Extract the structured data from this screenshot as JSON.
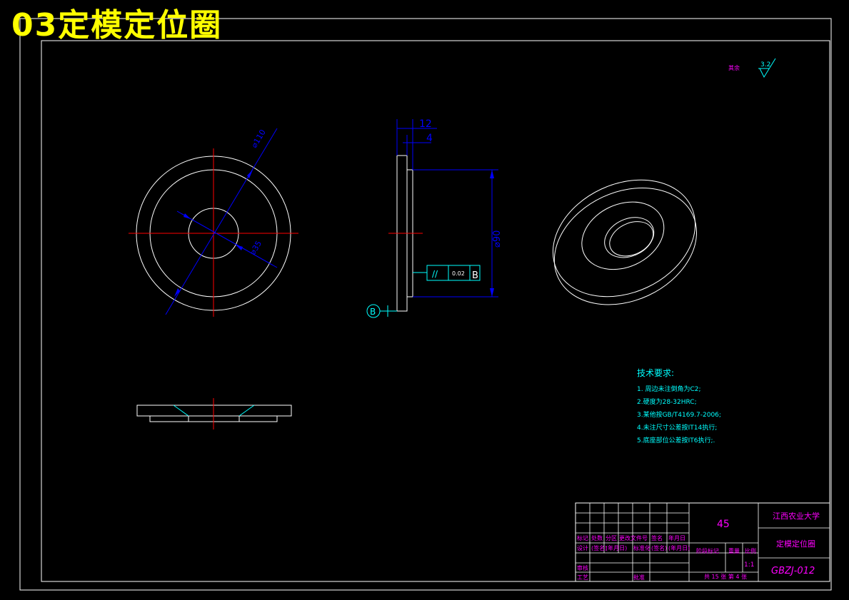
{
  "title": "03定模定位圈",
  "colors": {
    "background": "#000000",
    "outline": "#ffffff",
    "center_line": "#ff0000",
    "dimension": "#0000ff",
    "annotation": "#00ffff",
    "title_text": "#ffff00",
    "title_block_text": "#ff00ff"
  },
  "front_view": {
    "dim_outer": "⌀110",
    "dim_inner": "⌀35"
  },
  "side_view": {
    "dim_total_thickness": "12",
    "dim_flange_thickness": "4",
    "dim_boss_diameter": "⌀90",
    "tolerance_symbol": "//",
    "tolerance_value": "0.02",
    "tolerance_datum": "B",
    "datum_label": "B"
  },
  "roughness": {
    "label": "其余",
    "value": "3.2"
  },
  "tech_requirements": {
    "heading": "技术要求:",
    "items": [
      "1. 周边未注倒角为C2;",
      "2.硬度为28-32HRC;",
      "3.某他按GB/T4169.7-2006;",
      "4.未注尺寸公差按IT14执行;",
      "5.底座部位公差按IT6执行;."
    ]
  },
  "title_block": {
    "material": "45",
    "school": "江西农业大学",
    "part_name": "定模定位圈",
    "drawing_number": "GBZJ-012",
    "scale_value": "1:1",
    "sheet_info": "共 15 张 第 4 张",
    "header_labels": [
      "标记",
      "处数",
      "分区",
      "更改文件号",
      "签名",
      "年月日"
    ],
    "design_labels": [
      "设计",
      "(签名)",
      "(年月日)",
      "标准化",
      "(签名)",
      "(年月日)"
    ],
    "stage_label": "阶段标记",
    "weight_label": "重量",
    "scale_label": "比例",
    "review_label": "审核",
    "process_label": "工艺",
    "approve_label": "批准"
  }
}
